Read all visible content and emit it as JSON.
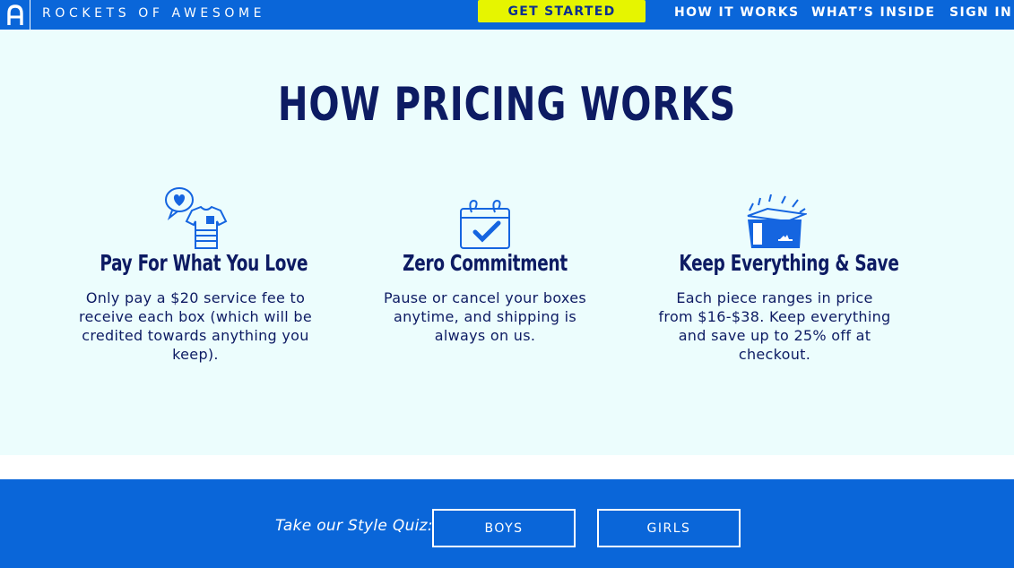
{
  "header": {
    "brand": "ROCKETS OF AWESOME",
    "cta_label": "GET STARTED",
    "nav_links": [
      "HOW IT WORKS",
      "WHAT’S INSIDE",
      "SIGN IN"
    ]
  },
  "pricing": {
    "title": "HOW PRICING WORKS",
    "features": [
      {
        "icon": "tshirt-heart-icon",
        "title": "Pay For What You Love",
        "text": "Only pay a $20 service fee to receive each box (which will be credited towards anything you keep)."
      },
      {
        "icon": "calendar-check-icon",
        "title": "Zero Commitment",
        "text": "Pause or cancel your boxes anytime, and shipping is always on us."
      },
      {
        "icon": "open-box-icon",
        "title": "Keep Everything & Save",
        "text": "Each piece ranges in price from $16-$38. Keep everything and save up to 25% off at checkout."
      }
    ]
  },
  "quiz": {
    "label": "Take our Style Quiz:",
    "buttons": [
      "BOYS",
      "GIRLS"
    ]
  },
  "colors": {
    "brand_blue": "#0a66d9",
    "cta_yellow": "#e6f500",
    "navy_text": "#0d1b63",
    "section_bg": "#ecfdfd"
  }
}
